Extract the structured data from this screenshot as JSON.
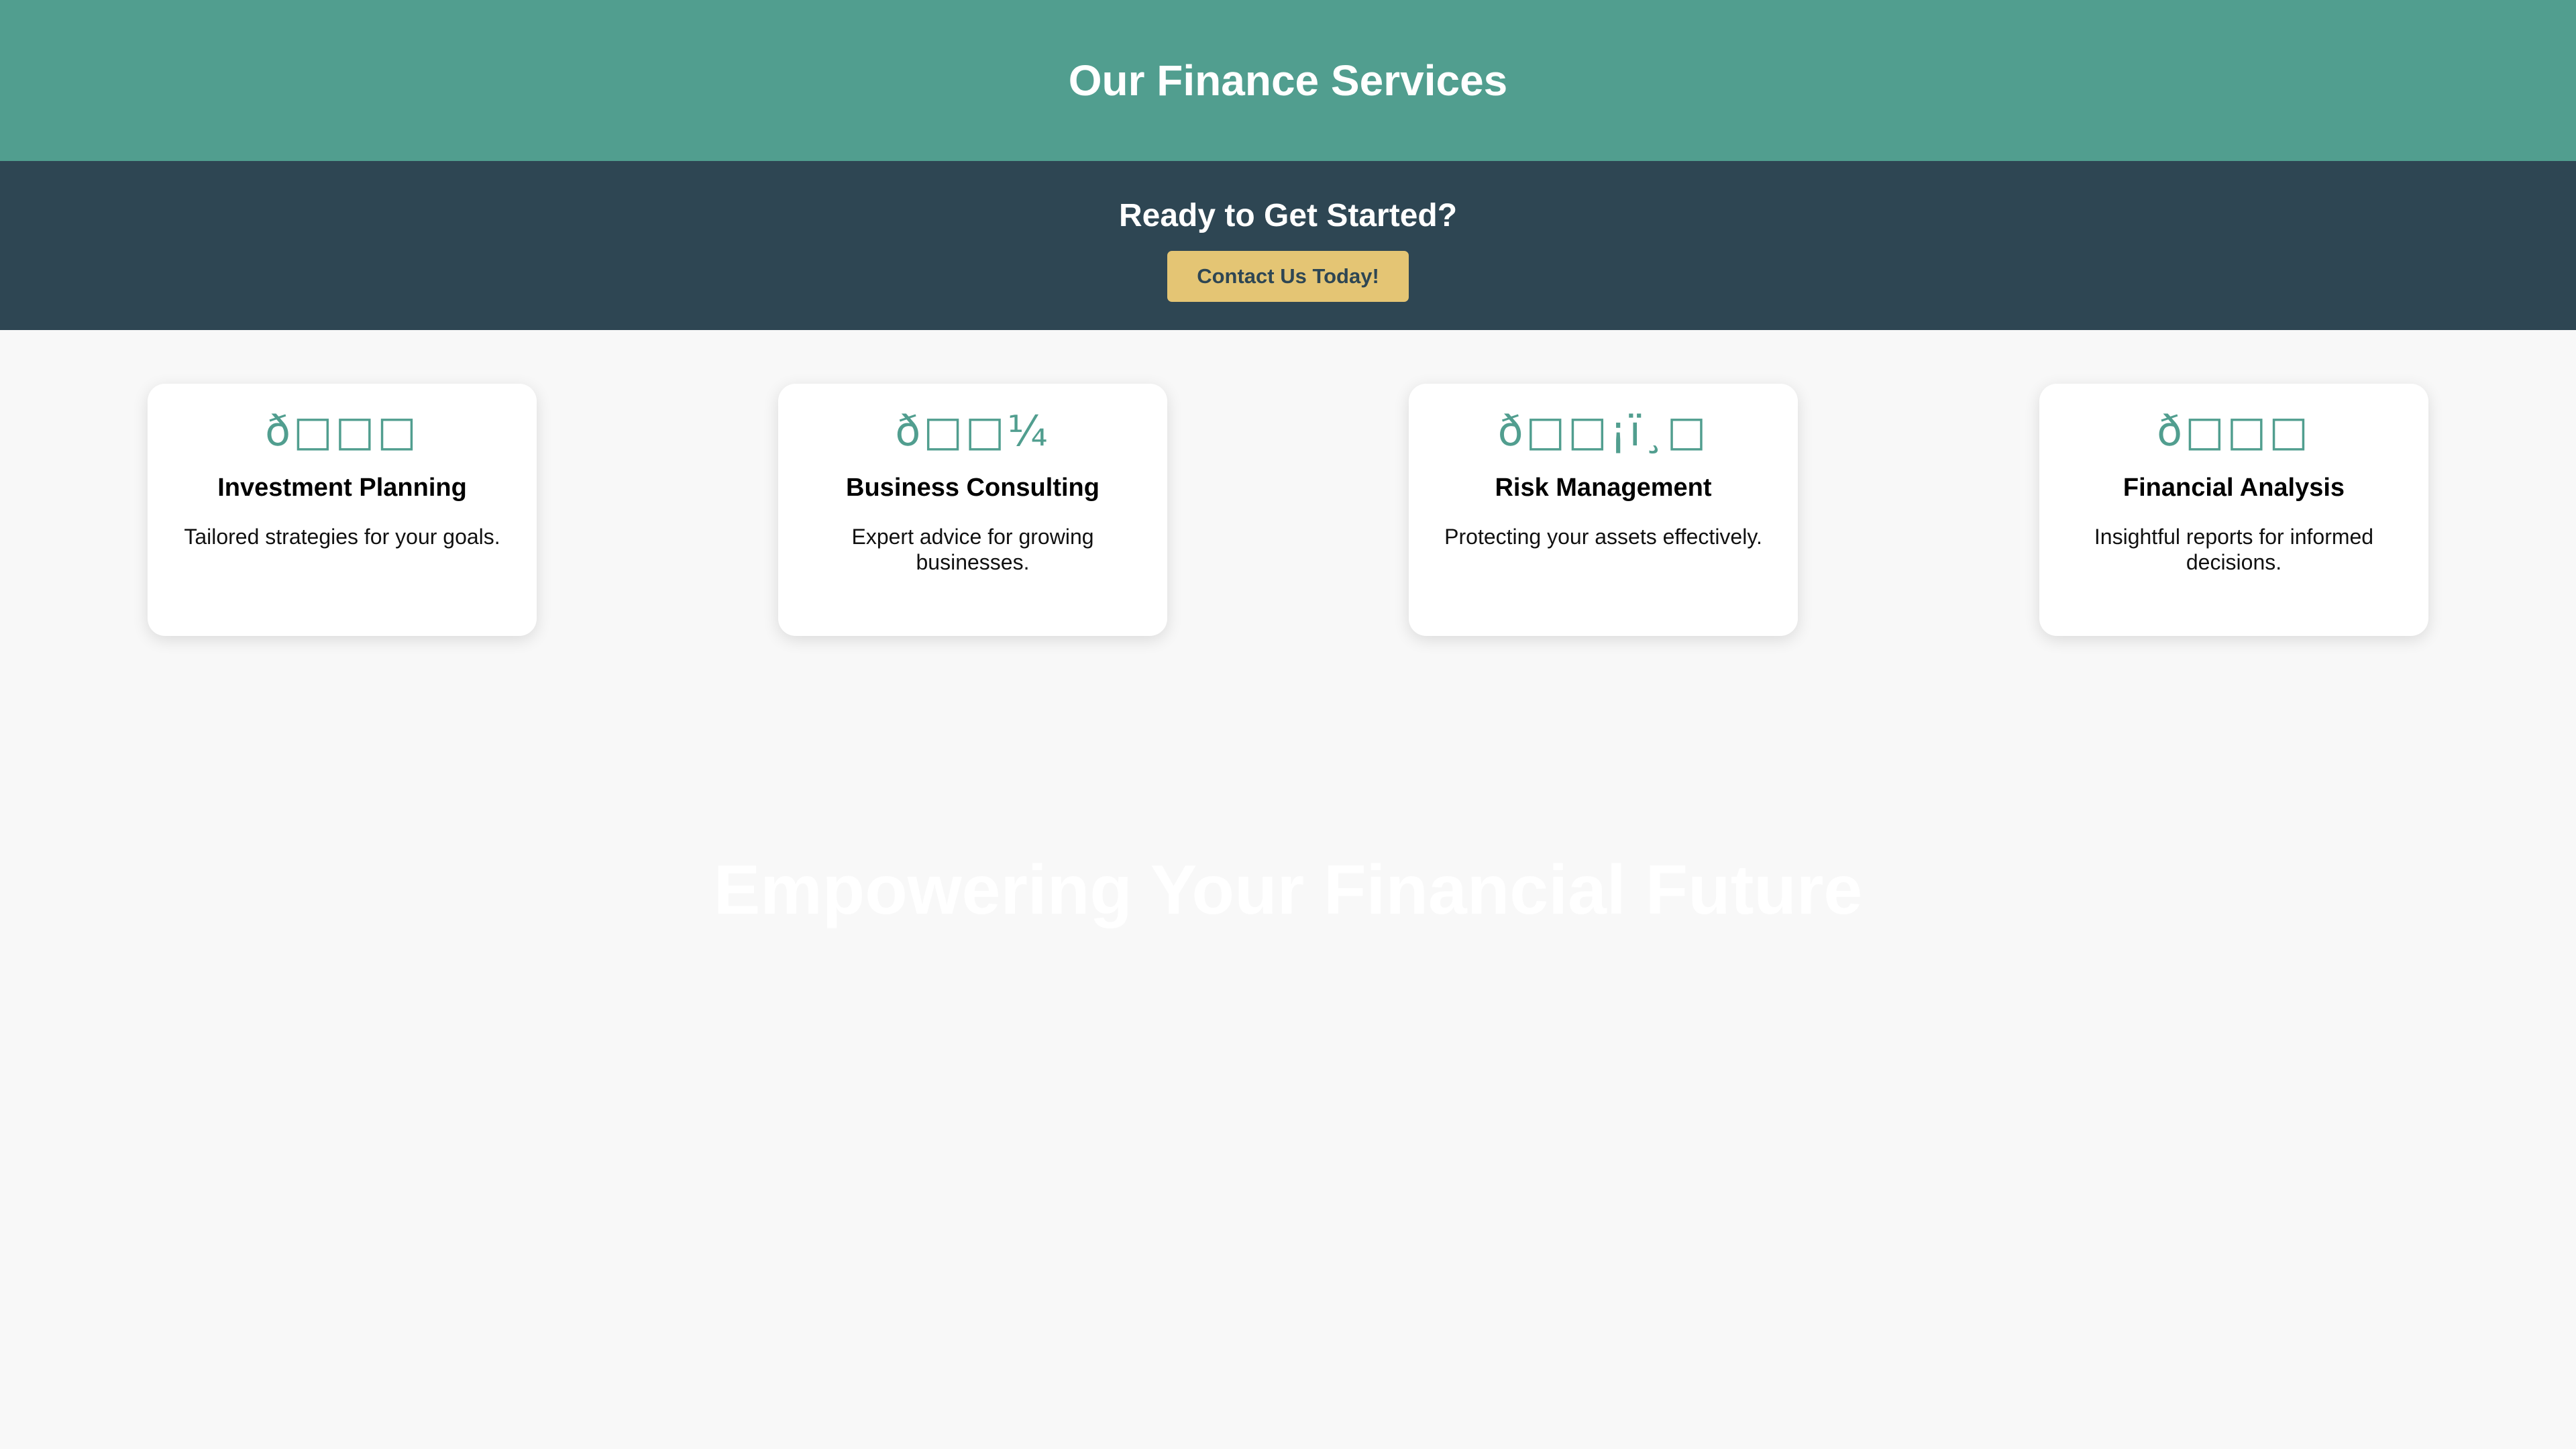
{
  "header": {
    "title": "Our Finance Services"
  },
  "cta": {
    "heading": "Ready to Get Started?",
    "button_label": "Contact Us Today!"
  },
  "services": [
    {
      "icon": "ð□□□",
      "icon_name": "investment-icon",
      "title": "Investment Planning",
      "description": "Tailored strategies for your goals."
    },
    {
      "icon": "ð□□¼",
      "icon_name": "business-icon",
      "title": "Business Consulting",
      "description": "Expert advice for growing businesses."
    },
    {
      "icon": "ð□□¡ï¸□",
      "icon_name": "shield-icon",
      "title": "Risk Management",
      "description": "Protecting your assets effectively."
    },
    {
      "icon": "ð□□□",
      "icon_name": "chart-icon",
      "title": "Financial Analysis",
      "description": "Insightful reports for informed decisions."
    }
  ],
  "hero": {
    "headline": "Empowering Your Financial Future"
  },
  "colors": {
    "header_bg": "#519e8f",
    "cta_bg": "#2e4653",
    "button_bg": "#e4c574",
    "page_bg": "#f8f8f8",
    "accent": "#519e8f"
  }
}
